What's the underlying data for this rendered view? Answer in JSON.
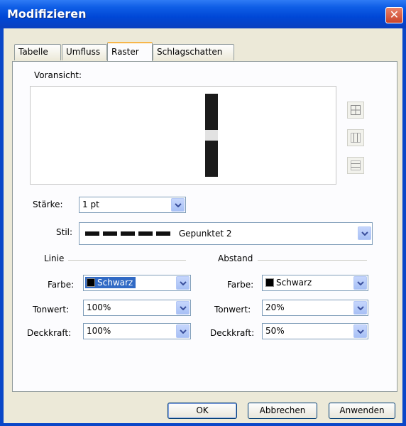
{
  "window": {
    "title": "Modifizieren",
    "close_symbol": "✕"
  },
  "tabs": [
    {
      "label": "Tabelle",
      "active": false
    },
    {
      "label": "Umfluss",
      "active": false
    },
    {
      "label": "Raster",
      "active": true
    },
    {
      "label": "Schlagschatten",
      "active": false
    }
  ],
  "preview": {
    "label": "Voransicht:",
    "icons": [
      "grid-all-borders-icon",
      "grid-vertical-borders-icon",
      "grid-horizontal-borders-icon"
    ]
  },
  "staerke": {
    "label": "Stärke:",
    "value": "1 pt"
  },
  "stil": {
    "label": "Stil:",
    "value": "Gepunktet 2"
  },
  "linie": {
    "heading": "Linie",
    "farbe": {
      "label": "Farbe:",
      "value": "Schwarz",
      "color": "#000000"
    },
    "tonwert": {
      "label": "Tonwert:",
      "value": "100%"
    },
    "deckkraft": {
      "label": "Deckkraft:",
      "value": "100%"
    }
  },
  "abstand": {
    "heading": "Abstand",
    "farbe": {
      "label": "Farbe:",
      "value": "Schwarz",
      "color": "#000000"
    },
    "tonwert": {
      "label": "Tonwert:",
      "value": "20%"
    },
    "deckkraft": {
      "label": "Deckkraft:",
      "value": "50%"
    }
  },
  "buttons": {
    "ok": "OK",
    "cancel": "Abbrechen",
    "apply": "Anwenden"
  },
  "colors": {
    "titlebar": "#0a47c8",
    "selection": "#316ac5",
    "tab_highlight": "#f7b64b"
  }
}
